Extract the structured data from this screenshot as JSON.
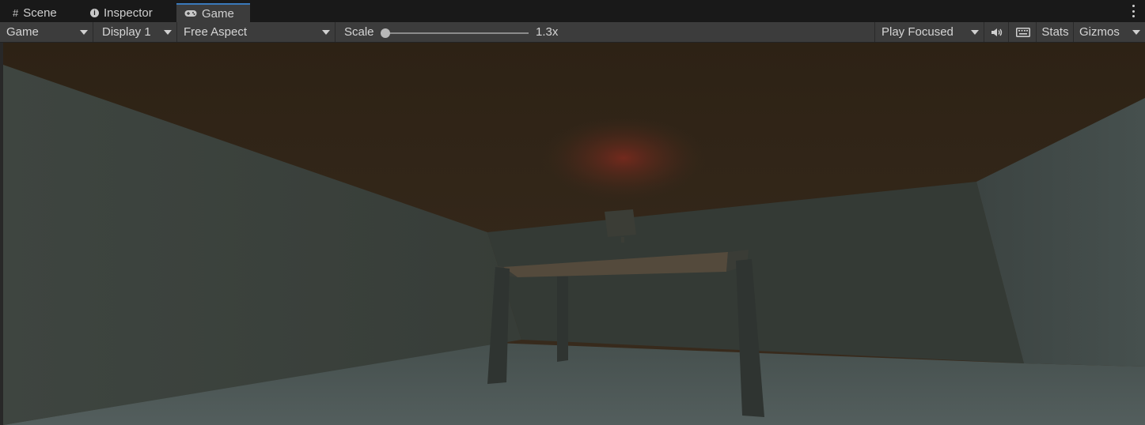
{
  "tabs": [
    {
      "label": "Scene",
      "icon": "grid-icon"
    },
    {
      "label": "Inspector",
      "icon": "info-icon"
    },
    {
      "label": "Game",
      "icon": "gamepad-icon"
    }
  ],
  "toolbar": {
    "view_mode": "Game",
    "display": "Display 1",
    "aspect": "Free Aspect",
    "scale_label": "Scale",
    "scale_value": "1.3x",
    "play_mode": "Play Focused",
    "stats_label": "Stats",
    "gizmos_label": "Gizmos",
    "audio_icon": "speaker-icon",
    "keyboard_icon": "keyboard-icon"
  },
  "colors": {
    "accent": "#3a79bb",
    "panel": "#3c3c3c",
    "tab_bg": "#191919"
  }
}
